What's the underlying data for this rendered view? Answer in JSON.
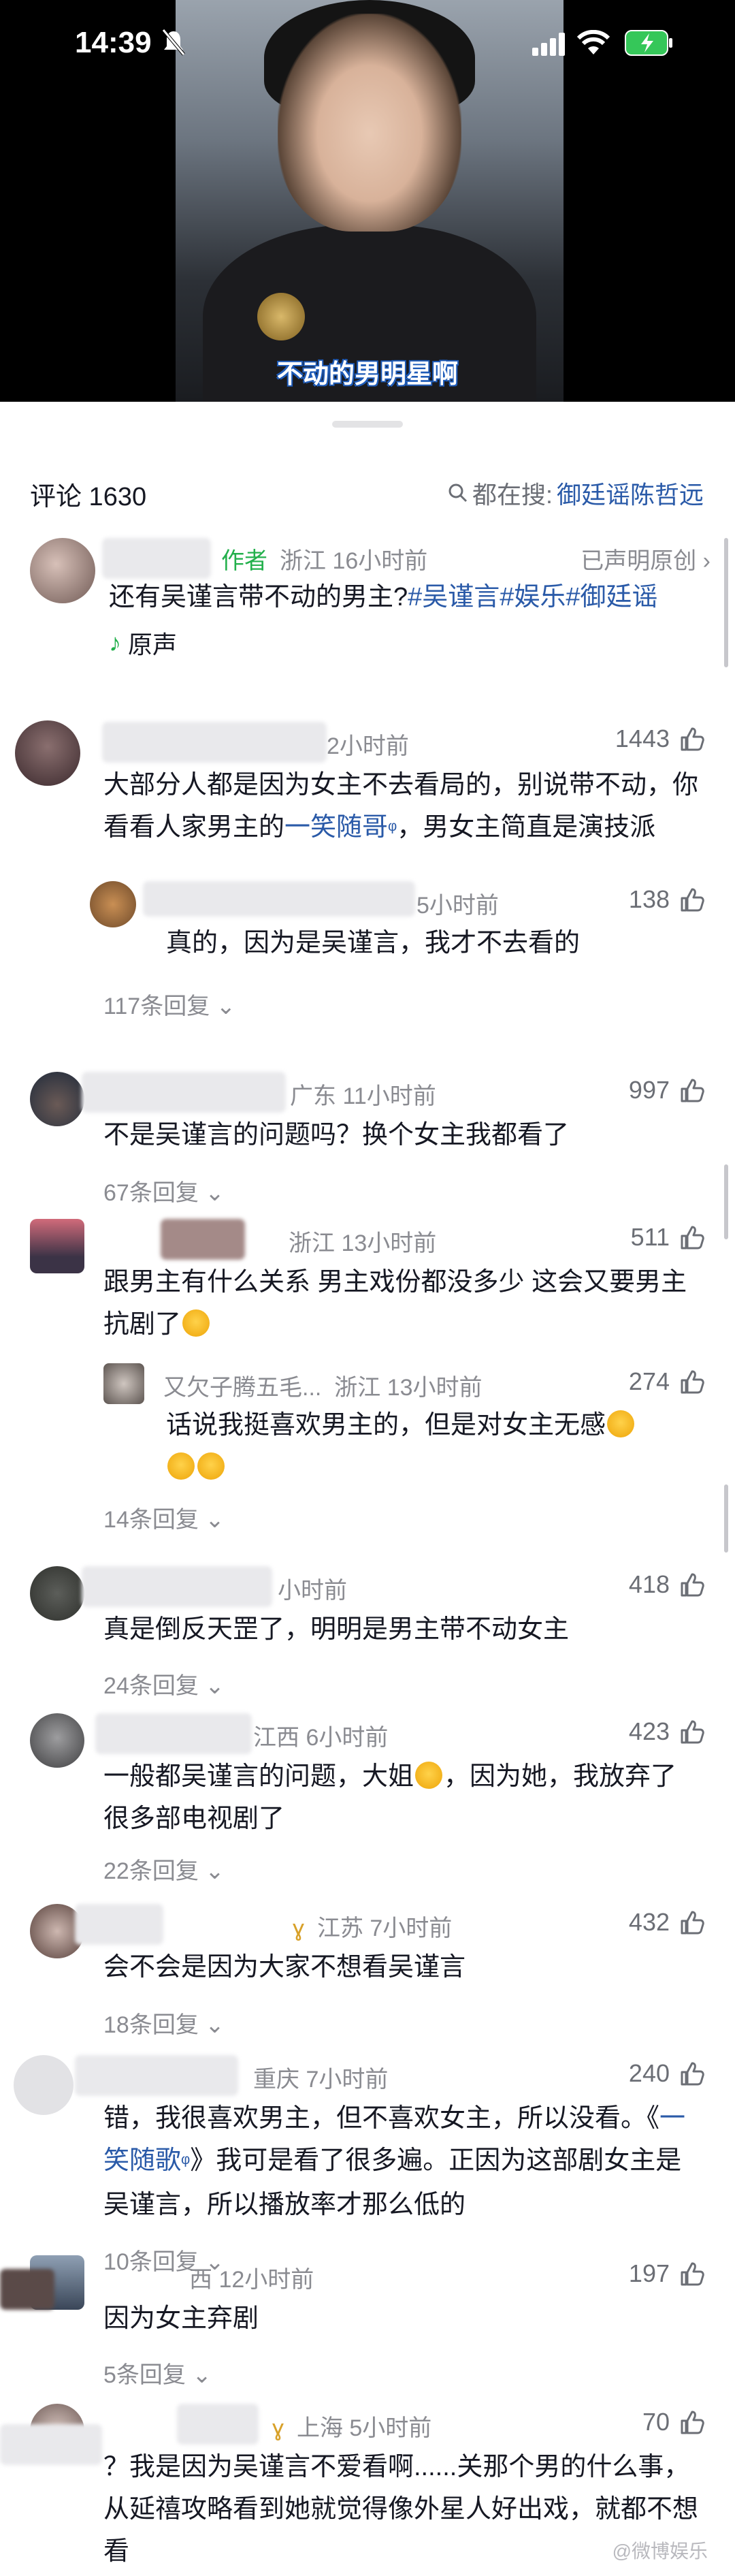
{
  "status": {
    "time": "14:39"
  },
  "video": {
    "subtitle": "不动的男明星啊"
  },
  "header": {
    "comment_count": "评论 1630",
    "search_prefix": "都在搜:",
    "search_term": "御廷谣陈哲远"
  },
  "pinned": {
    "author_tag": "作者",
    "meta": "浙江 16小时前",
    "declared": "已声明原创",
    "text": "还有吴谨言带不动的男主?",
    "hashtags": "#吴谨言#娱乐#御廷谣",
    "sound": "原声"
  },
  "comments": [
    {
      "meta": "2小时前",
      "likes": "1443",
      "text_a": "大部分人都是因为女主不去看局的，别说带不动，你看看人家男主的",
      "mention": "一笑随哥",
      "text_b": "，男女主简直是演技派",
      "reply": {
        "meta": "5小时前",
        "likes": "138",
        "text": "真的，因为是吴谨言，我才不去看的"
      },
      "more": "117条回复"
    },
    {
      "meta": "广东 11小时前",
      "likes": "997",
      "text": "不是吴谨言的问题吗？换个女主我都看了",
      "more": "67条回复"
    },
    {
      "meta": "浙江 13小时前",
      "likes": "511",
      "text": "跟男主有什么关系 男主戏份都没多少 这会又要男主抗剧了",
      "reply": {
        "name": "又欠子腾五毛...",
        "meta": "浙江 13小时前",
        "likes": "274",
        "text": "话说我挺喜欢男主的，但是对女主无感"
      },
      "more": "14条回复"
    },
    {
      "meta": "小时前",
      "likes": "418",
      "text": "真是倒反天罡了，明明是男主带不动女主",
      "more": "24条回复"
    },
    {
      "meta": "江西 6小时前",
      "likes": "423",
      "text_a": "一般都吴谨言的问题，大姐",
      "text_b": "，因为她，我放弃了很多部电视剧了",
      "more": "22条回复"
    },
    {
      "meta": "江苏 7小时前",
      "likes": "432",
      "text": "会不会是因为大家不想看吴谨言",
      "more": "18条回复"
    },
    {
      "meta": "重庆 7小时前",
      "likes": "240",
      "text_a": "错，我很喜欢男主，但不喜欢女主，所以没看。《",
      "mention": "一笑随歌",
      "text_b": "》我可是看了很多遍。正因为这部剧女主是吴谨言，所以播放率才那么低的",
      "more": "10条回复"
    },
    {
      "meta": "西 12小时前",
      "likes": "197",
      "text": "因为女主弃剧",
      "more": "5条回复"
    },
    {
      "meta": "上海 5小时前",
      "likes": "70",
      "text": "？我是因为吴谨言不爱看啊......关那个男的什么事，从延禧攻略看到她就觉得像外星人好出戏，就都不想看"
    }
  ],
  "watermark": "@微博娱乐"
}
